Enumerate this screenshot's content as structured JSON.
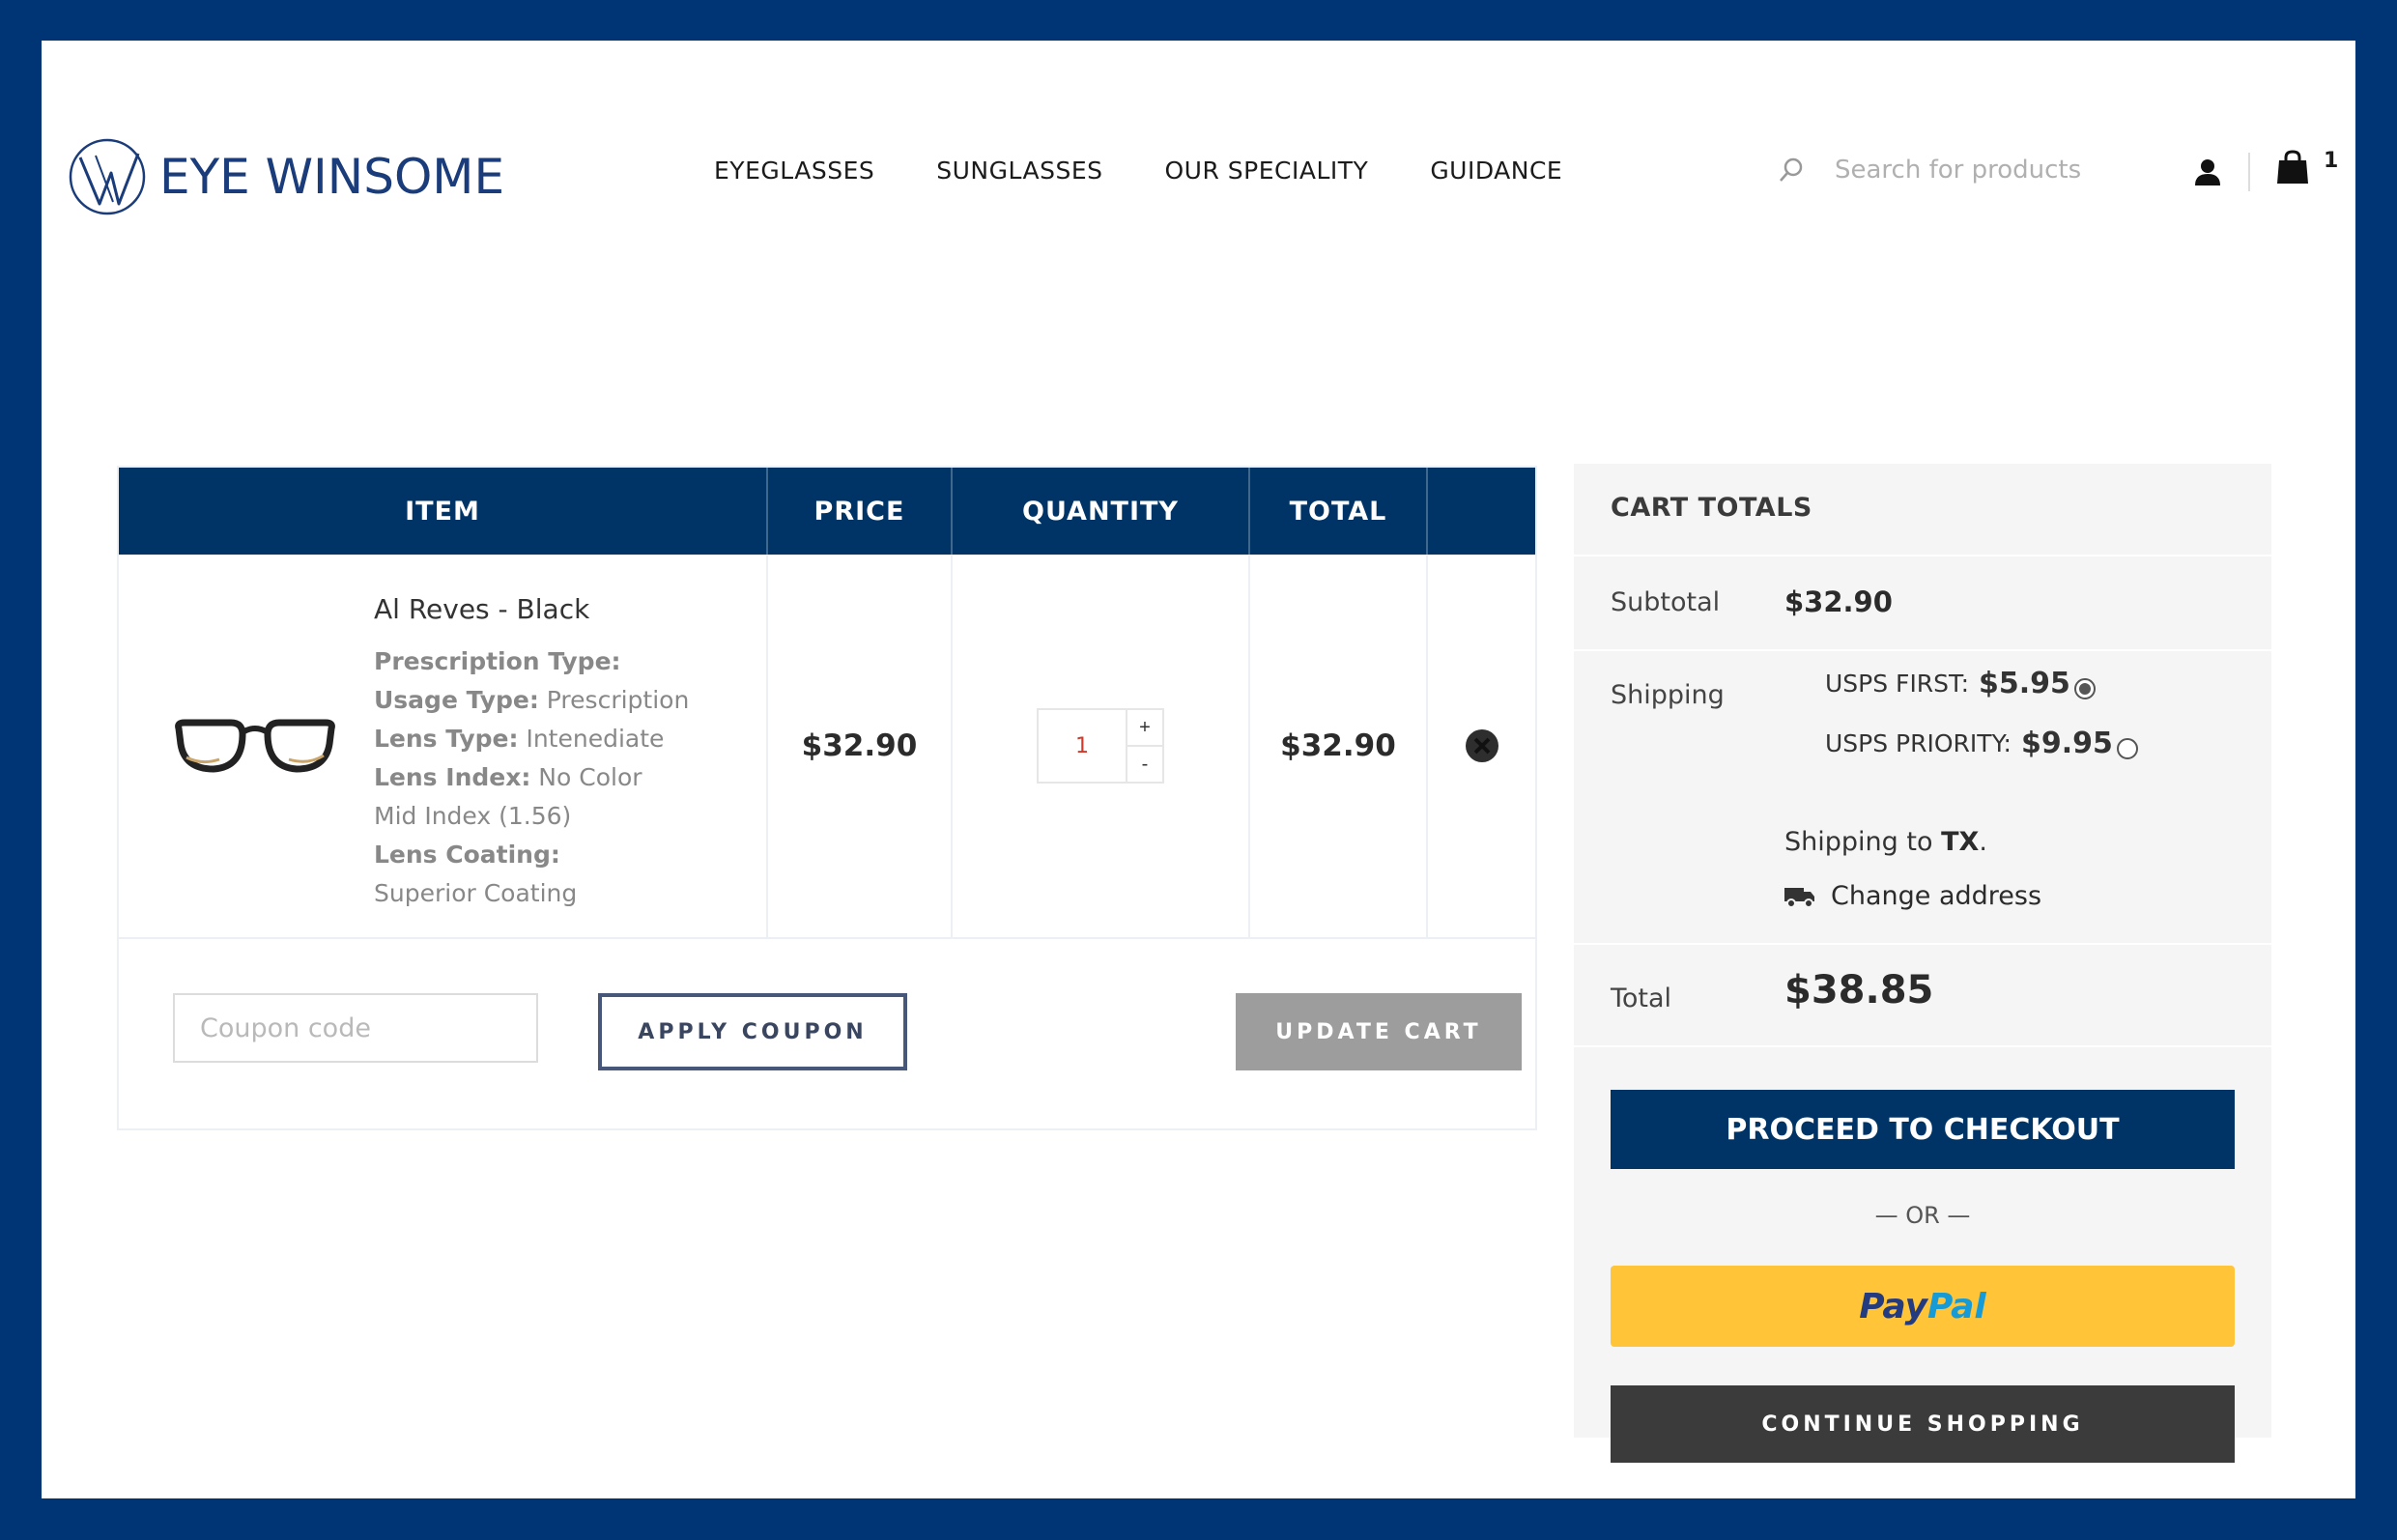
{
  "brand": {
    "name": "EYE WINSOME",
    "color": "#1a3c7a"
  },
  "nav": [
    "EYEGLASSES",
    "SUNGLASSES",
    "OUR SPECIALITY",
    "GUIDANCE"
  ],
  "search": {
    "placeholder": "Search for products",
    "icon": "search-icon"
  },
  "header": {
    "cart_count": "1",
    "user_icon": "user-icon",
    "bag_icon": "shopping-bag-icon"
  },
  "cart": {
    "headers": {
      "item": "ITEM",
      "price": "PRICE",
      "quantity": "QUANTITY",
      "total": "TOTAL"
    },
    "items": [
      {
        "name": "Al Reves - Black",
        "details": [
          {
            "label": "Prescription Type:",
            "value": ""
          },
          {
            "label": "Usage Type:",
            "value": "Prescription"
          },
          {
            "label": "Lens Type:",
            "value": "Intenediate"
          },
          {
            "label": "Lens Index:",
            "value": "No Color"
          },
          {
            "label": "",
            "value": "Mid Index (1.56)"
          },
          {
            "label": "Lens Coating:",
            "value": ""
          },
          {
            "label": "",
            "value": "Superior Coating"
          }
        ],
        "price": "$32.90",
        "quantity": "1",
        "total": "$32.90",
        "plus": "+",
        "minus": "-"
      }
    ],
    "coupon_placeholder": "Coupon code",
    "apply_coupon": "APPLY COUPON",
    "update_cart": "UPDATE CART"
  },
  "totals": {
    "title": "CART TOTALS",
    "subtotal_label": "Subtotal",
    "subtotal": "$32.90",
    "shipping_label": "Shipping",
    "shipping_options": [
      {
        "name": "USPS FIRST:",
        "price": "$5.95",
        "selected": true
      },
      {
        "name": "USPS PRIORITY:",
        "price": "$9.95",
        "selected": false
      }
    ],
    "shipping_to_prefix": "Shipping to",
    "shipping_to_state": "TX",
    "shipping_to_suffix": ".",
    "change_address": "Change address",
    "total_label": "Total",
    "total": "$38.85",
    "checkout": "PROCEED TO CHECKOUT",
    "or": "— OR —",
    "paypal_a": "Pay",
    "paypal_b": "Pal",
    "continue": "CONTINUE SHOPPING"
  },
  "colors": {
    "frame": "#003575",
    "primary": "#003466",
    "paypal": "#ffc438",
    "dark_button": "#3b3b3b",
    "update_button": "#9d9d9d"
  }
}
